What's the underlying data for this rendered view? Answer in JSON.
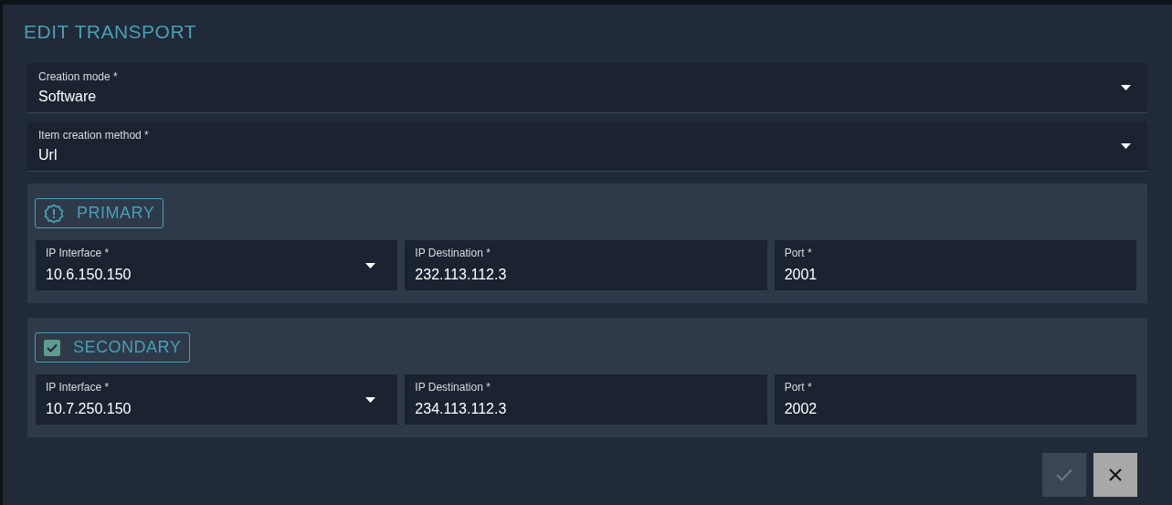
{
  "dialog": {
    "title": "EDIT TRANSPORT"
  },
  "fields": [
    {
      "label": "Creation mode *",
      "value": "Software",
      "kind": "select"
    },
    {
      "label": "Item creation method *",
      "value": "Url",
      "kind": "select"
    }
  ],
  "sections": [
    {
      "title": "PRIMARY",
      "kind": "status",
      "fields": [
        {
          "label": "IP Interface *",
          "value": "10.6.150.150",
          "kind": "select"
        },
        {
          "label": "IP Destination *",
          "value": "232.113.112.3",
          "kind": "text"
        },
        {
          "label": "Port *",
          "value": "2001",
          "kind": "text"
        }
      ]
    },
    {
      "title": "SECONDARY",
      "kind": "checkbox",
      "checked": true,
      "fields": [
        {
          "label": "IP Interface *",
          "value": "10.7.250.150",
          "kind": "select"
        },
        {
          "label": "IP Destination *",
          "value": "234.113.112.3",
          "kind": "text"
        },
        {
          "label": "Port *",
          "value": "2002",
          "kind": "text"
        }
      ]
    }
  ],
  "buttons": [
    {
      "kind": "confirm",
      "disabled": true
    },
    {
      "kind": "cancel",
      "disabled": false
    }
  ]
}
